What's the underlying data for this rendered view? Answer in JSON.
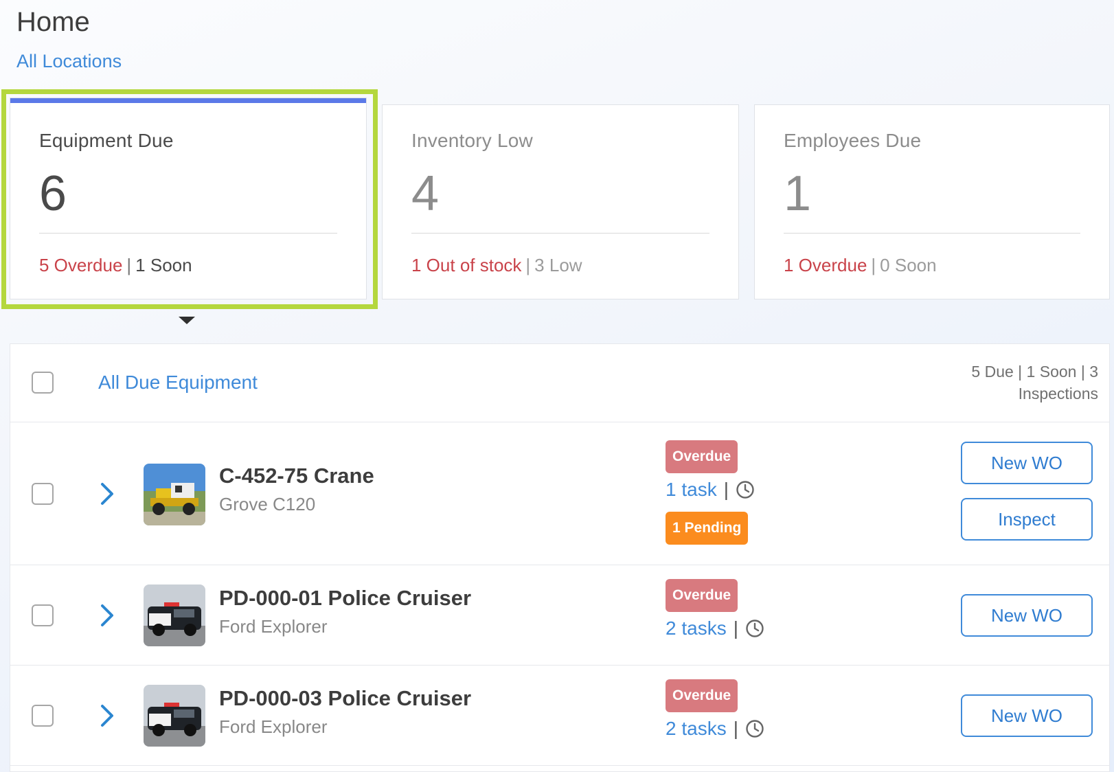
{
  "header": {
    "title": "Home",
    "location_link": "All Locations"
  },
  "cards": [
    {
      "title": "Equipment Due",
      "count": "6",
      "stat_primary": "5 Overdue",
      "separator": "|",
      "stat_secondary": "1 Soon"
    },
    {
      "title": "Inventory Low",
      "count": "4",
      "stat_primary": "1 Out of stock",
      "separator": "|",
      "stat_secondary": "3 Low"
    },
    {
      "title": "Employees Due",
      "count": "1",
      "stat_primary": "1 Overdue",
      "separator": "|",
      "stat_secondary": "0 Soon"
    }
  ],
  "panel": {
    "all_link": "All Due Equipment",
    "summary": "5 Due | 1 Soon | 3 Inspections"
  },
  "rows": [
    {
      "name": "C-452-75 Crane",
      "model": "Grove C120",
      "status": "Overdue",
      "tasks": "1 task",
      "separator": "|",
      "pending": "1 Pending",
      "new_wo": "New WO",
      "inspect": "Inspect"
    },
    {
      "name": "PD-000-01 Police Cruiser",
      "model": "Ford Explorer",
      "status": "Overdue",
      "tasks": "2 tasks",
      "separator": "|",
      "new_wo": "New WO"
    },
    {
      "name": "PD-000-03 Police Cruiser",
      "model": "Ford Explorer",
      "status": "Overdue",
      "tasks": "2 tasks",
      "separator": "|",
      "new_wo": "New WO"
    }
  ],
  "colors": {
    "accent": "#3f8ad9",
    "highlight": "#b4d73e",
    "card_bar": "#5b79e8",
    "overdue_text": "#c9434a",
    "overdue_badge": "#d87a7f",
    "pending_badge": "#fb8c1e"
  },
  "icons": {
    "chevron": "chevron-right-icon",
    "clock": "clock-icon",
    "caret": "caret-down-icon"
  }
}
